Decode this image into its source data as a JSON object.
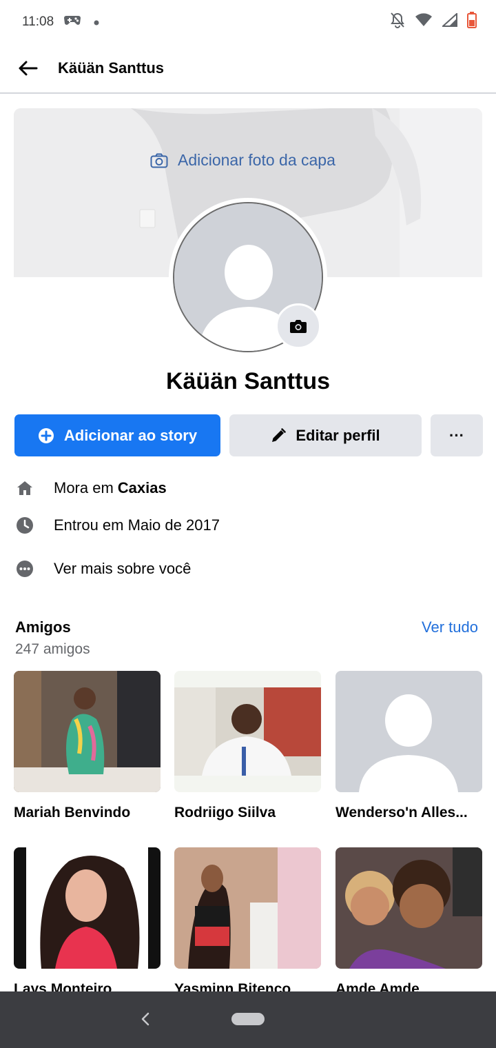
{
  "status_bar": {
    "time": "11:08",
    "icons": [
      "game-icon",
      "dot-icon",
      "bell-off-icon",
      "wifi-icon",
      "signal-icon",
      "battery-icon"
    ]
  },
  "app_bar": {
    "title": "Käüän Santtus"
  },
  "cover": {
    "add_label": "Adicionar foto da capa"
  },
  "profile": {
    "name": "Käüän Santtus"
  },
  "actions": {
    "story_label": "Adicionar ao story",
    "edit_label": "Editar perfil",
    "more_label": "···"
  },
  "details": {
    "lives_prefix": "Mora em",
    "lives_city": "Caxias",
    "joined": "Entrou em Maio de 2017",
    "see_more": "Ver mais sobre você"
  },
  "friends": {
    "title": "Amigos",
    "count": "247 amigos",
    "see_all": "Ver tudo",
    "items": [
      {
        "name": "Mariah Benvindo"
      },
      {
        "name": "Rodriigo Siilva"
      },
      {
        "name": "Wenderso'n Alles..."
      },
      {
        "name": "Lays Monteiro"
      },
      {
        "name": "Yasminn Bitenco"
      },
      {
        "name": "Amde Amde"
      }
    ]
  },
  "colors": {
    "primary": "#1877f2",
    "link": "#216fdb",
    "secondary_button": "#e4e6eb",
    "nav_bar": "#3c3d41"
  }
}
